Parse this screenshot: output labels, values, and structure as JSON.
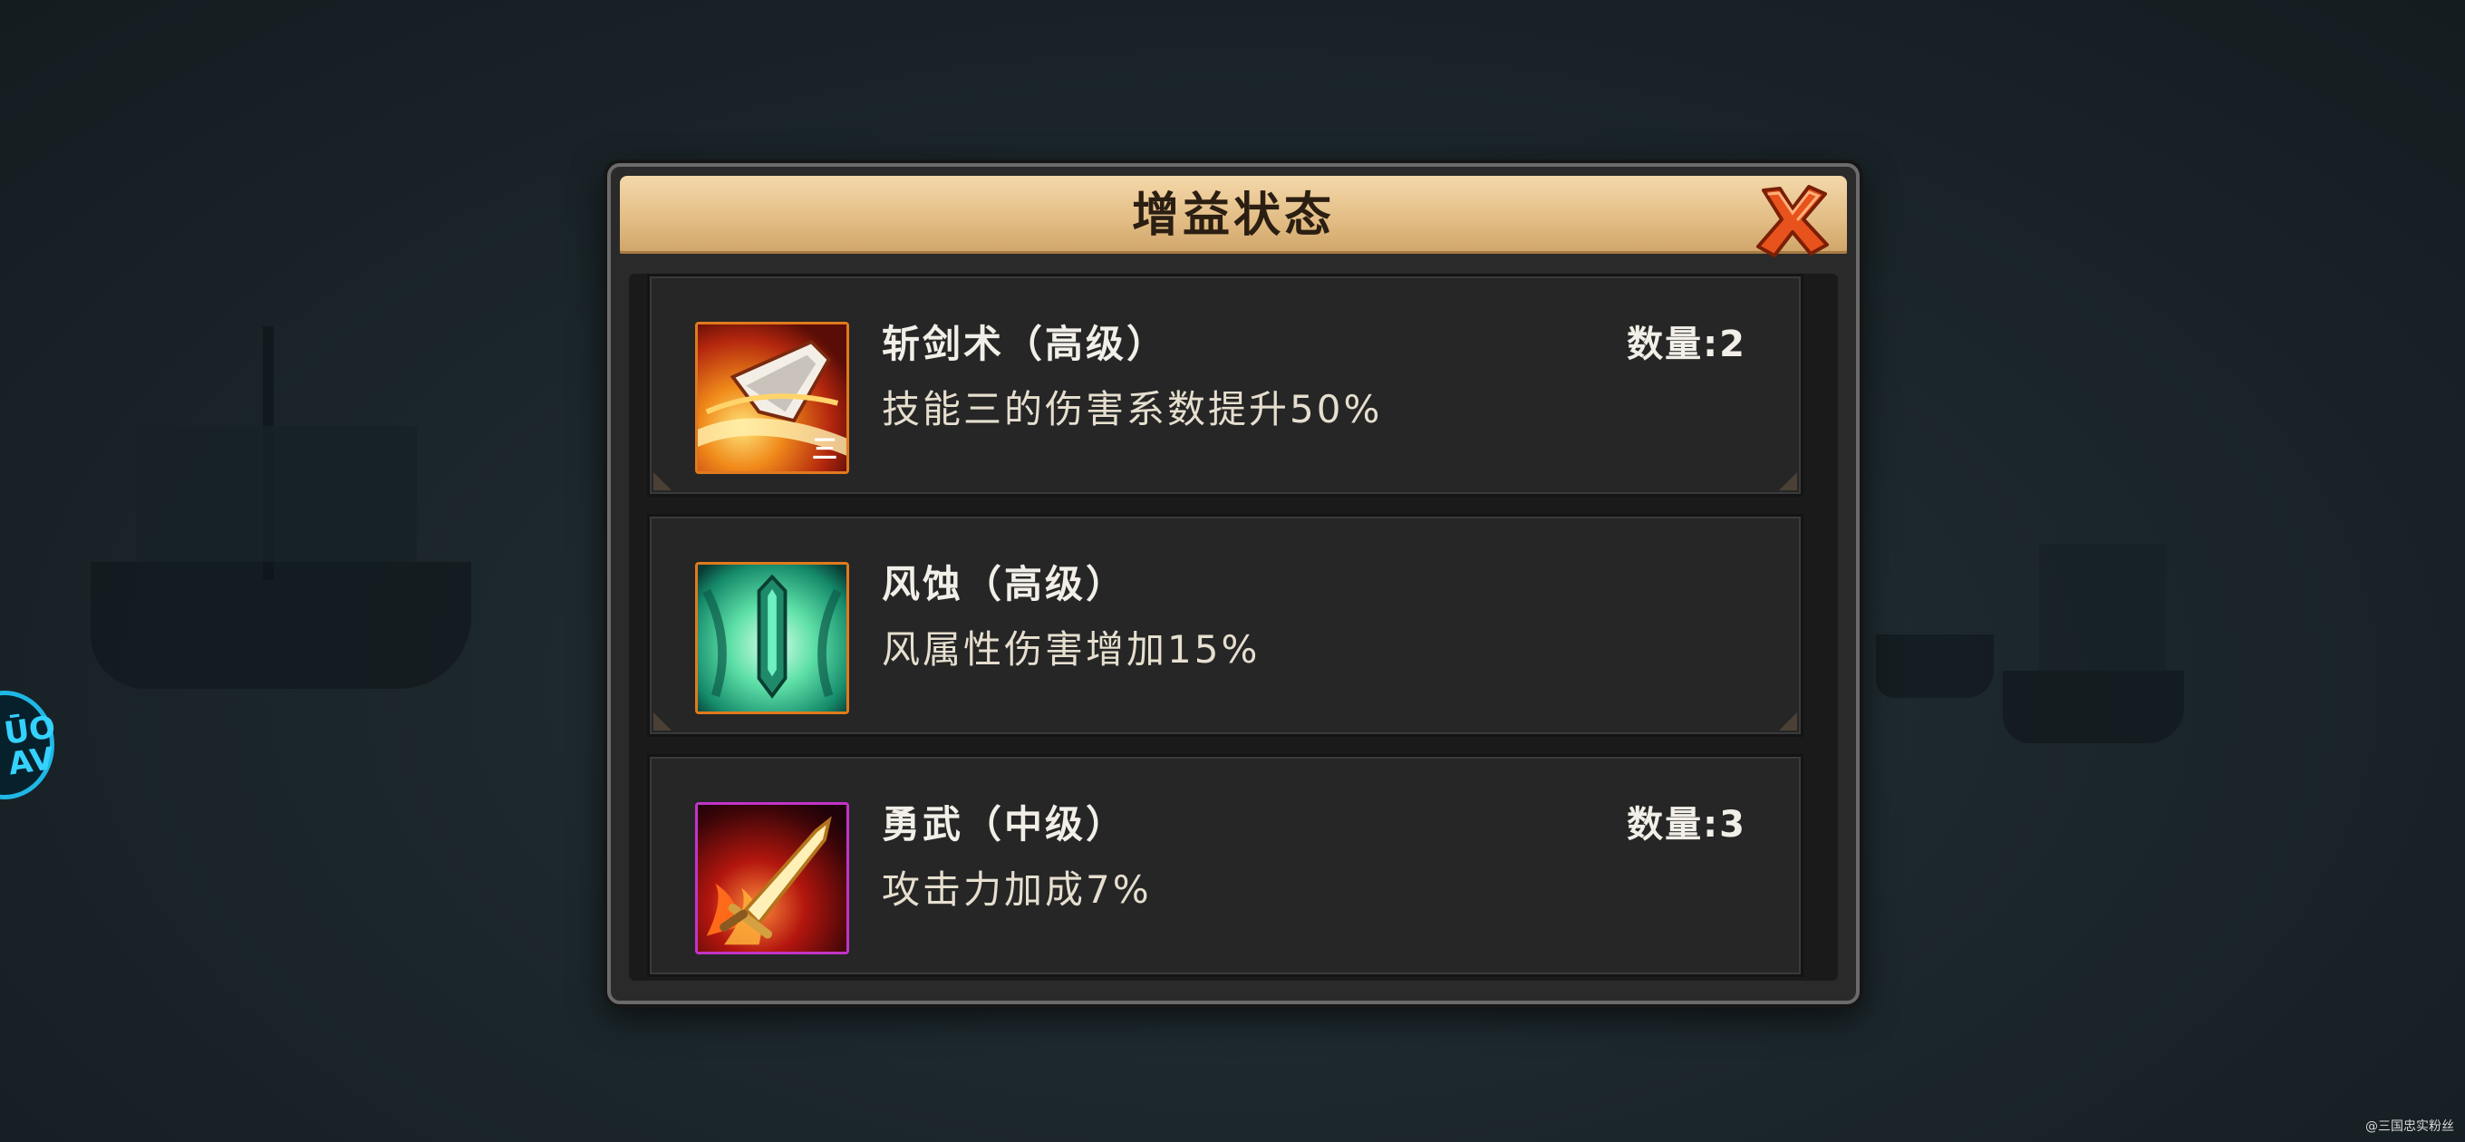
{
  "dialog": {
    "title": "增益状态",
    "close_icon": "close-x-icon"
  },
  "buffs": [
    {
      "name": "斩剑术（高级）",
      "description": "技能三的伤害系数提升50%",
      "count_label": "数量:2",
      "icon": "slash-sword-icon",
      "icon_badge": "三",
      "frame_color": "#e07a1e"
    },
    {
      "name": "风蚀（高级）",
      "description": "风属性伤害增加15%",
      "count_label": "",
      "icon": "wind-erosion-icon",
      "frame_color": "#e07a1e"
    },
    {
      "name": "勇武（中级）",
      "description": "攻击力加成7%",
      "count_label": "数量:3",
      "icon": "valor-blade-icon",
      "frame_color": "#c234c8"
    }
  ],
  "side_badge": {
    "text": "ŪO AV",
    "icon": "event-badge-icon"
  },
  "watermark": "@三国忠实粉丝",
  "colors": {
    "header_bg": "#e3be86",
    "panel_bg": "#262626",
    "text_primary": "#f2efe8",
    "close_red": "#e04a1a"
  }
}
